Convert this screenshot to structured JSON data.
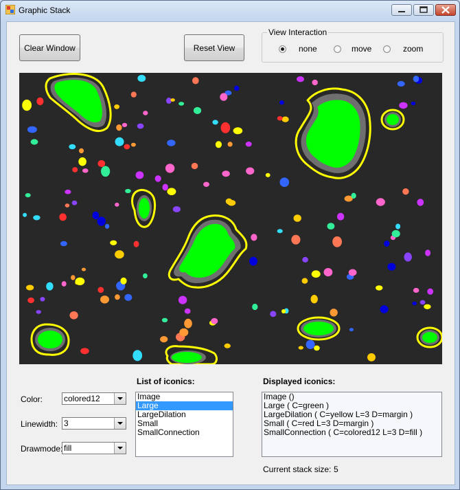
{
  "window": {
    "title": "Graphic Stack"
  },
  "toolbar": {
    "clear_label": "Clear Window",
    "reset_label": "Reset View"
  },
  "view_interaction": {
    "legend": "View Interaction",
    "options": [
      "none",
      "move",
      "zoom"
    ],
    "selected": "none"
  },
  "controls": {
    "color_label": "Color:",
    "color_value": "colored12",
    "linewidth_label": "Linewidth:",
    "linewidth_value": "3",
    "drawmode_label": "Drawmode:",
    "drawmode_value": "fill"
  },
  "iconics": {
    "heading": "List of iconics:",
    "items": [
      "Image",
      "Large",
      "LargeDilation",
      "Small",
      "SmallConnection"
    ],
    "selected": "Large"
  },
  "displayed": {
    "heading": "Displayed iconics:",
    "lines": [
      "Image  ()",
      "Large  ( C=green )",
      "LargeDilation  ( C=yellow  L=3  D=margin )",
      "Small  ( C=red  L=3  D=margin )",
      "SmallConnection  ( C=colored12  L=3  D=fill )"
    ]
  },
  "stack": {
    "label": "Current stack size:",
    "value": "5"
  },
  "colors": {
    "large_region": "#00ff00",
    "dilation_fill": "#6f6f6f",
    "dilation_outline": "#ffff00",
    "selection": "#3399ff"
  },
  "icons": [
    "app-icon",
    "minimize-icon",
    "maximize-icon",
    "close-icon",
    "chevron-down-icon"
  ]
}
